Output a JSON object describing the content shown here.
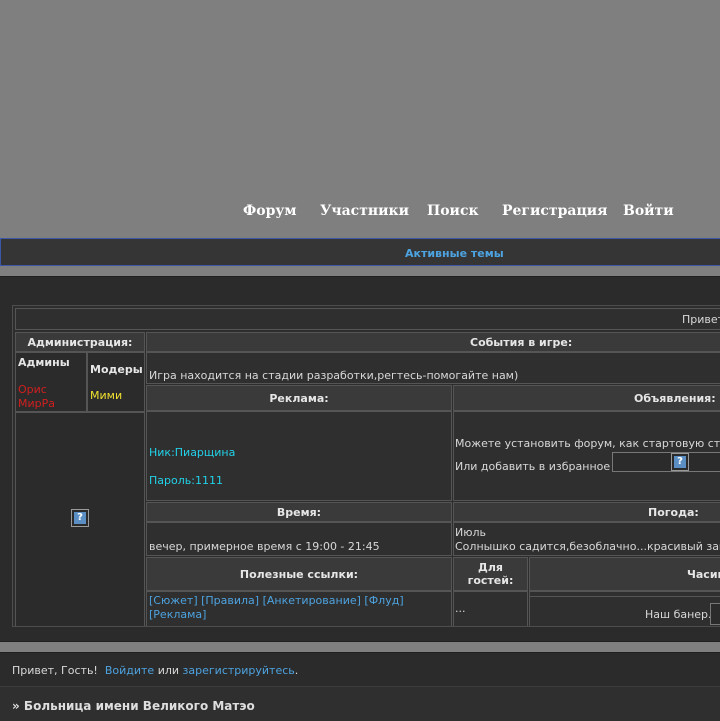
{
  "nav": {
    "forum": "Форум",
    "members": "Участники",
    "search": "Поиск",
    "register": "Регистрация",
    "login": "Войти"
  },
  "active_topics": "Активные темы",
  "greeting_top": "Привет",
  "admin": {
    "header": "Администрация:",
    "admins_label": "Админы",
    "mods_label": "Модеры",
    "admin_names": [
      "Орис",
      "МирРа"
    ],
    "mod_name": "Мими",
    "icon": "help-image-icon"
  },
  "events": {
    "header": "События в игре:",
    "text": "Игра находится на стадии разработки,регтесь-помогайте нам)"
  },
  "ads": {
    "header": "Реклама:",
    "nick": "Ник:Пиарщина",
    "password": "Пароль:1111"
  },
  "announcements": {
    "header": "Объявления:",
    "line1": "Можете установить форум, как стартовую стр",
    "line2": "Или добавить в избранное"
  },
  "time": {
    "header": "Время:",
    "text": "вечер, примерное время с 19:00 - 21:45"
  },
  "weather": {
    "header": "Погода:",
    "month": "Июль",
    "text": "Солнышко садится,безоблачно...красивый зак"
  },
  "links": {
    "header": "Полезные ссылки:",
    "items": [
      "[Сюжет]",
      "[Правила]",
      "[Анкетирование]",
      "[Флуд]",
      "[Реклама]"
    ]
  },
  "guests": {
    "header": "Для гостей:",
    "text": "..."
  },
  "hours": {
    "header": "Часик",
    "banner": "Наш банер."
  },
  "footer": {
    "hello": "Привет, Гость!",
    "login_link": "Войдите",
    "or": "или",
    "register_link": "зарегистрируйтесь",
    "dot": ".",
    "forum_name": "» Больница имени Великого Матэо"
  },
  "colors": {
    "background": "#7f7f7f",
    "panel": "#2b2b2b",
    "link": "#4da3e0",
    "cyan": "#22d1e8",
    "admin_red": "#d11f1f",
    "mod_yellow": "#f0e030"
  }
}
